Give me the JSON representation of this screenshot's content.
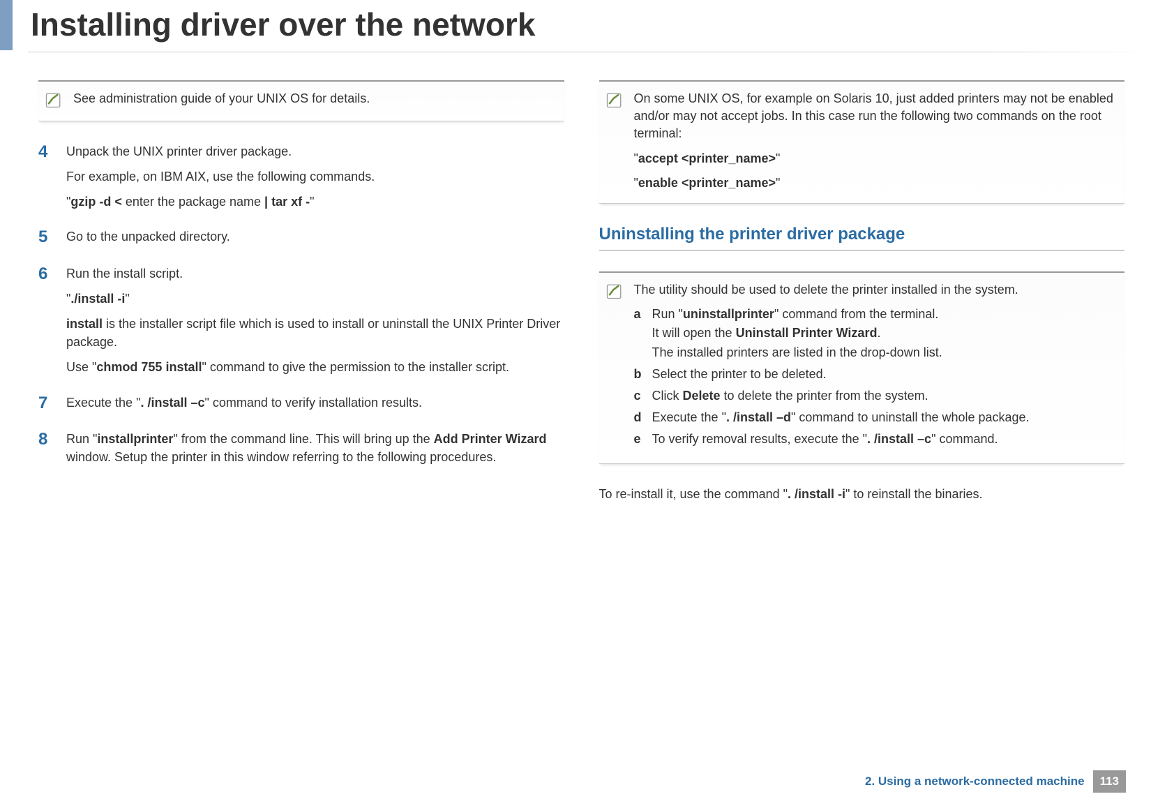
{
  "title": "Installing driver over the network",
  "left": {
    "note1": "See administration guide of your UNIX OS for details.",
    "step4": {
      "num": "4",
      "p1": "Unpack the UNIX printer driver package.",
      "p2": "For example, on IBM AIX, use the following commands.",
      "p3_pre": "\"",
      "p3_b1": "gzip -d <",
      "p3_mid": " enter the package name ",
      "p3_b2": "| tar xf -",
      "p3_post": "\""
    },
    "step5": {
      "num": "5",
      "p1": "Go to the unpacked directory."
    },
    "step6": {
      "num": "6",
      "p1": "Run the install script.",
      "p2_pre": "\"",
      "p2_b": "./install -i",
      "p2_post": "\"",
      "p3_b": "install",
      "p3_rest": " is the installer script file which is used to install or uninstall the UNIX Printer Driver package.",
      "p4_pre": "Use \"",
      "p4_b": "chmod 755 install",
      "p4_post": "\" command to give the permission to the installer script."
    },
    "step7": {
      "num": "7",
      "p1_pre": "Execute the \"",
      "p1_b": ". /install –c",
      "p1_post": "\" command to verify installation results."
    },
    "step8": {
      "num": "8",
      "p1_pre": "Run \"",
      "p1_b1": "installprinter",
      "p1_mid": "\" from the command line. This will bring up the ",
      "p1_b2": "Add Printer Wizard",
      "p1_post": " window. Setup the printer in this window referring to the following procedures."
    }
  },
  "right": {
    "note1": {
      "p1": "On some UNIX OS, for example on Solaris 10, just added printers may not be enabled and/or may not accept jobs. In this case run the following two commands on the root terminal:",
      "p2_pre": "\"",
      "p2_b": "accept <printer_name>",
      "p2_post": "\"",
      "p3_pre": "\"",
      "p3_b": "enable <printer_name>",
      "p3_post": "\""
    },
    "heading": "Uninstalling the printer driver package",
    "note2": {
      "intro": "The utility should be used to delete the printer installed in the system.",
      "a": {
        "l": "a",
        "p1_pre": "Run \"",
        "p1_b": "uninstallprinter",
        "p1_post": "\" command from the terminal.",
        "p2_pre": "It will open the ",
        "p2_b": "Uninstall Printer Wizard",
        "p2_post": ".",
        "p3": "The installed printers are listed in the drop-down list."
      },
      "b": {
        "l": "b",
        "t": "Select the printer to be deleted."
      },
      "c": {
        "l": "c",
        "pre": "Click ",
        "b": "Delete",
        "post": " to delete the printer from the system."
      },
      "d": {
        "l": "d",
        "pre": "Execute the \"",
        "b": ". /install –d",
        "post": "\" command to uninstall the whole package."
      },
      "e": {
        "l": "e",
        "pre": "To verify removal results, execute the \"",
        "b": ". /install –c",
        "post": "\" command."
      }
    },
    "para_pre": "To re-install it, use the command \"",
    "para_b": ". /install -i",
    "para_post": "\" to reinstall the binaries."
  },
  "footer": {
    "text": "2.  Using a network-connected machine",
    "page": "113"
  }
}
